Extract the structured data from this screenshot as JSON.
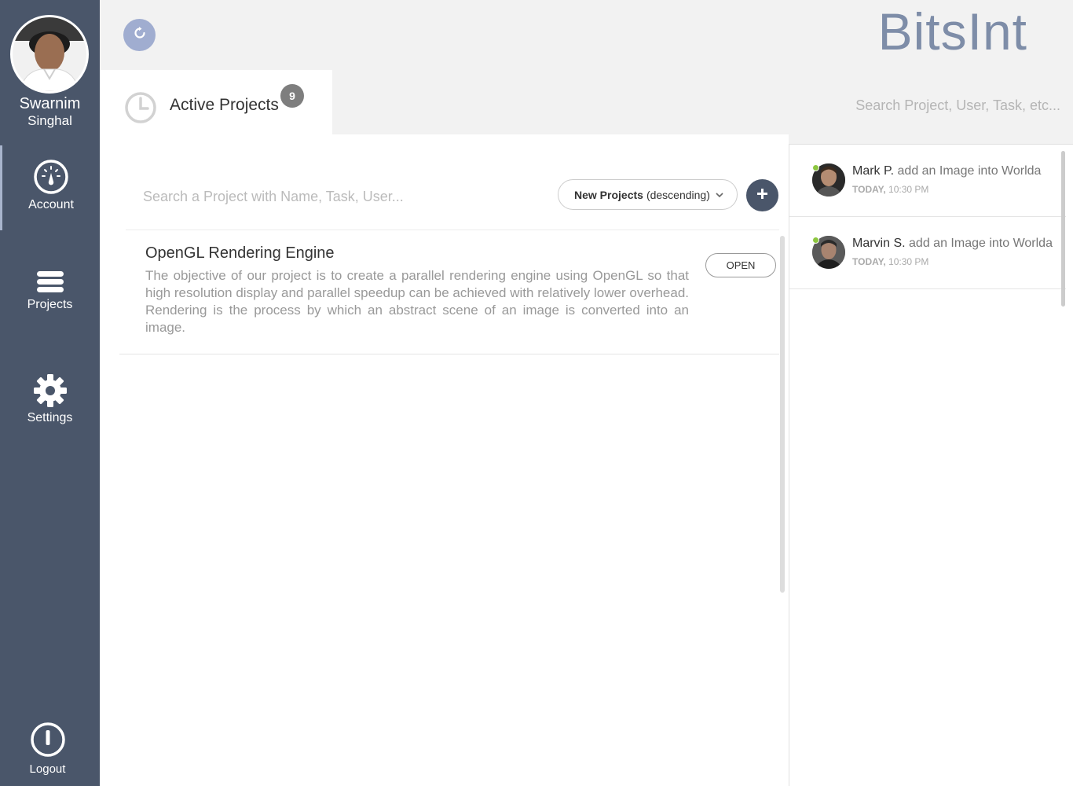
{
  "user": {
    "first_name": "Swarnim",
    "last_name": "Singhal"
  },
  "nav": {
    "account": "Account",
    "projects": "Projects",
    "settings": "Settings",
    "logout": "Logout"
  },
  "header": {
    "brand": "BitsInt",
    "search_placeholder": "Search Project, User, Task, etc...",
    "tab_label": "Active Projects",
    "tab_badge": "9"
  },
  "toolbar": {
    "search_placeholder": "Search a Project with Name, Task, User...",
    "sort_strong": "New Projects",
    "sort_rest": "(descending)"
  },
  "projects": [
    {
      "title": "OpenGL Rendering Engine",
      "description": "The objective of our project is to create a parallel rendering engine using OpenGL so that high resolution display and parallel speedup can be achieved with relatively lower overhead. Rendering is the process by which an abstract scene of an image is converted into an image.",
      "action": "OPEN"
    }
  ],
  "activity": [
    {
      "who": "Mark P.",
      "action": "add an Image into Worlda",
      "day": "TODAY,",
      "time": "10:30 PM"
    },
    {
      "who": "Marvin S.",
      "action": "add an Image into Worlda",
      "day": "TODAY,",
      "time": "10:30 PM"
    }
  ],
  "colors": {
    "sidebar": "#4a566a",
    "brand": "#7e8da8",
    "refresh": "#a0add0",
    "online": "#8cc63f"
  },
  "icons": [
    "refresh-icon",
    "gauge-icon",
    "menu-icon",
    "gear-icon",
    "power-icon",
    "clock-icon",
    "chevron-down-icon",
    "plus-icon"
  ]
}
